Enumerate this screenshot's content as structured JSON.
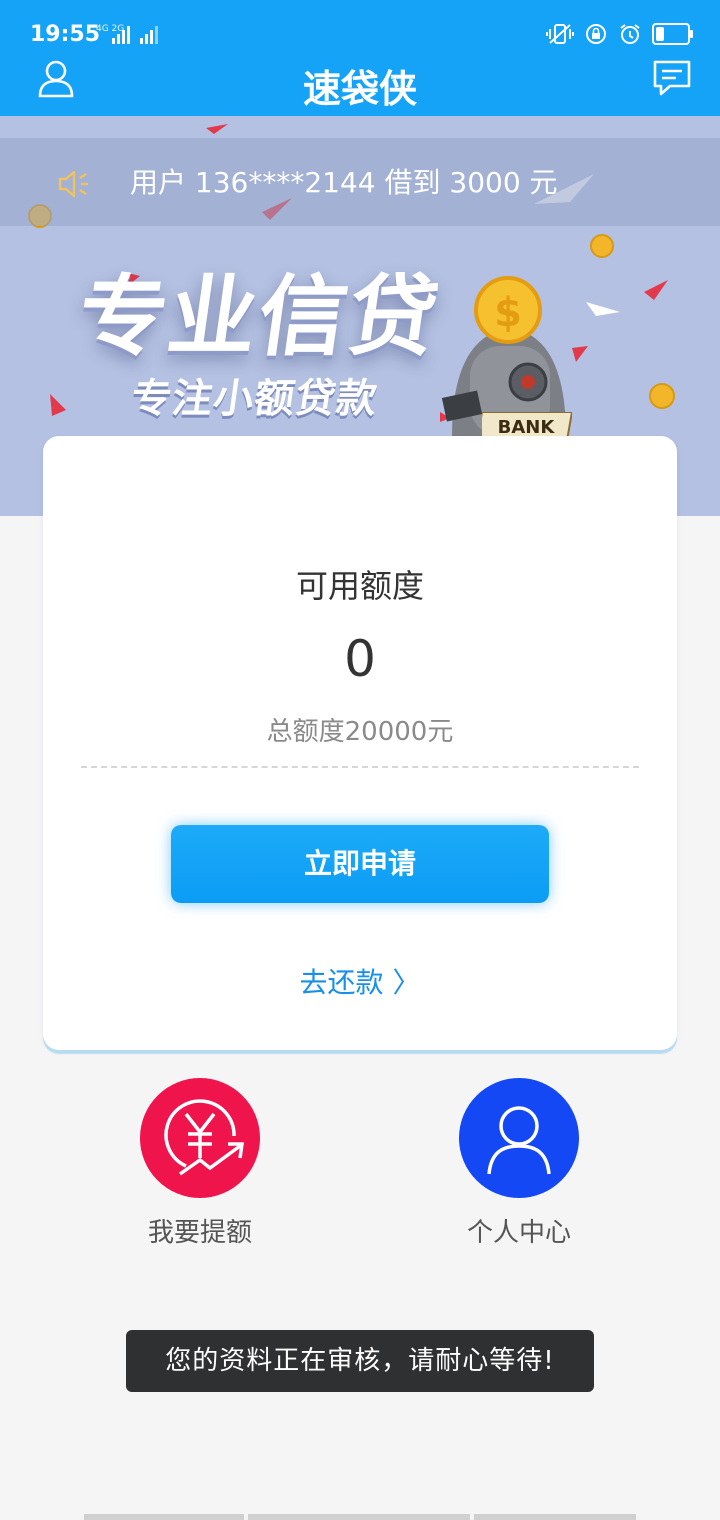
{
  "status_bar": {
    "time": "19:55",
    "network_label": "4G 2G"
  },
  "header": {
    "title": "速袋侠"
  },
  "banner": {
    "notice": "用户 136****2144 借到 3000 元",
    "title": "专业信贷",
    "subtitle": "专注小额贷款",
    "bank_label": "BANK"
  },
  "card": {
    "available_label": "可用额度",
    "available_amount": "0",
    "total_limit": "总额度20000元",
    "apply_button": "立即申请",
    "repay_link": "去还款 〉"
  },
  "features": [
    {
      "label": "我要提额",
      "color": "#f0144d"
    },
    {
      "label": "个人中心",
      "color": "#1448f4"
    }
  ],
  "toast": "您的资料正在审核，请耐心等待!",
  "colors": {
    "brand": "#14a3f6",
    "link": "#1890ea"
  }
}
